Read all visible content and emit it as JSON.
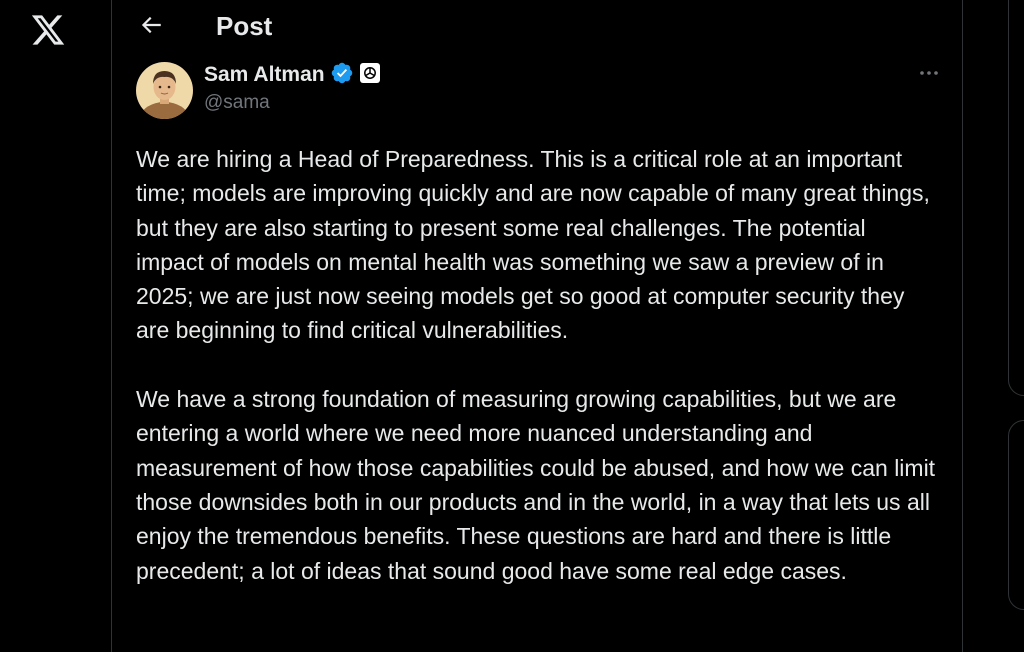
{
  "header": {
    "title": "Post"
  },
  "author": {
    "display_name": "Sam Altman",
    "handle": "@sama"
  },
  "post": {
    "paragraphs": [
      "We are hiring a Head of Preparedness. This is a critical role at an important time; models are improving quickly and are now capable of many great things, but they are also starting to present some real challenges. The potential impact of models on mental health was something we saw a preview of in 2025; we are just now seeing models get so good at computer security they are beginning to find critical vulnerabilities.",
      "We have a strong foundation of measuring growing capabilities, but we are entering a world where we need more nuanced understanding and measurement of how those capabilities could be abused, and how we can limit those downsides both in our products and in the world, in a way that lets us all enjoy the tremendous benefits.  These questions are hard and there is little precedent; a lot of ideas that sound good have some real edge cases."
    ]
  },
  "icons": {
    "logo": "x-logo-icon",
    "back": "arrow-left-icon",
    "verified": "verified-badge-icon",
    "affiliate": "openai-affiliate-icon",
    "more": "more-horizontal-icon"
  },
  "colors": {
    "background": "#000000",
    "text": "#e7e9ea",
    "secondary_text": "#71767b",
    "border": "#2f3336",
    "verified_blue": "#1d9bf0"
  }
}
